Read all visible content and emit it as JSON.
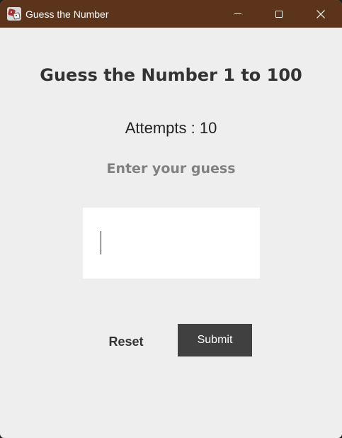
{
  "window": {
    "title": "Guess the Number",
    "icon": "dice-icon",
    "controls": [
      "minimize-icon",
      "maximize-icon",
      "close-icon"
    ],
    "titlebar_color": "#5b341b"
  },
  "game": {
    "heading": "Guess the Number 1 to 100",
    "attempts_label": "Attempts : 10",
    "prompt": "Enter your guess",
    "guess_value": "",
    "reset_label": "Reset",
    "submit_label": "Submit"
  }
}
